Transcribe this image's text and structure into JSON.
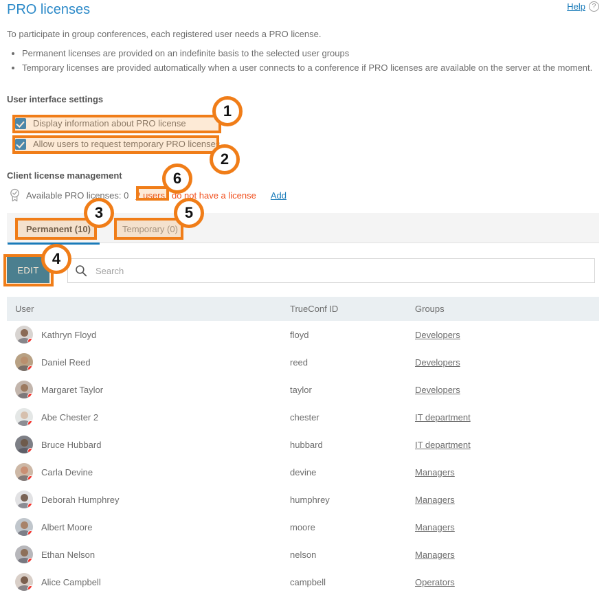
{
  "header": {
    "title": "PRO licenses",
    "help_label": "Help",
    "help_icon": "question-circle-icon"
  },
  "intro": {
    "text": "To participate in group conferences, each registered user needs a PRO license.",
    "bullets": [
      "Permanent licenses are provided on an indefinite basis to the selected user groups",
      "Temporary licenses are provided automatically when a user connects to a conference if PRO licenses are available on the server at the moment."
    ]
  },
  "ui_settings": {
    "heading": "User interface settings",
    "checkboxes": [
      {
        "label": "Display information about PRO license",
        "checked": true
      },
      {
        "label": "Allow users to request temporary PRO licenses",
        "checked": true
      }
    ]
  },
  "client_license": {
    "heading": "Client license management",
    "medal_icon": "award-medal-icon",
    "available_text": "Available PRO licenses: 0",
    "no_license_link": "2 users",
    "no_license_rest": "do not have a license",
    "add_label": "Add"
  },
  "tabs": [
    {
      "label": "Permanent (10)",
      "active": true
    },
    {
      "label": "Temporary (0)",
      "active": false
    }
  ],
  "toolbar": {
    "edit_label": "EDIT",
    "search_placeholder": "Search",
    "search_value": "",
    "search_icon": "search-icon"
  },
  "table": {
    "columns": [
      "User",
      "TrueConf ID",
      "Groups"
    ],
    "rows": [
      {
        "user": "Kathryn Floyd",
        "id": "floyd",
        "group": "Developers",
        "status": "offline"
      },
      {
        "user": "Daniel Reed",
        "id": "reed",
        "group": "Developers",
        "status": "offline"
      },
      {
        "user": "Margaret Taylor",
        "id": "taylor",
        "group": "Developers",
        "status": "offline"
      },
      {
        "user": "Abe Chester 2",
        "id": "chester",
        "group": "IT department",
        "status": "offline"
      },
      {
        "user": "Bruce Hubbard",
        "id": "hubbard",
        "group": "IT department",
        "status": "offline"
      },
      {
        "user": "Carla Devine",
        "id": "devine",
        "group": "Managers",
        "status": "offline"
      },
      {
        "user": "Deborah Humphrey",
        "id": "humphrey",
        "group": "Managers",
        "status": "offline"
      },
      {
        "user": "Albert Moore",
        "id": "moore",
        "group": "Managers",
        "status": "offline"
      },
      {
        "user": "Ethan Nelson",
        "id": "nelson",
        "group": "Managers",
        "status": "offline"
      },
      {
        "user": "Alice Campbell",
        "id": "campbell",
        "group": "Operators",
        "status": "offline"
      }
    ]
  },
  "annotations": {
    "accent_color": "#f07d18",
    "markers": [
      {
        "number": "1",
        "target": "display-info-checkbox-row"
      },
      {
        "number": "2",
        "target": "allow-temporary-checkbox-row"
      },
      {
        "number": "3",
        "target": "tab-permanent"
      },
      {
        "number": "4",
        "target": "edit-button"
      },
      {
        "number": "5",
        "target": "tab-temporary"
      },
      {
        "number": "6",
        "target": "no-license-users-link"
      }
    ]
  }
}
